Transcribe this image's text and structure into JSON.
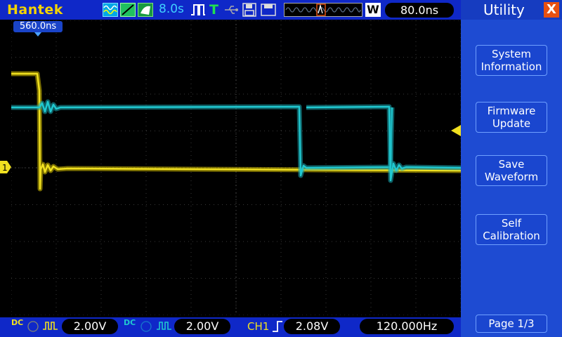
{
  "brand": "Hantek",
  "topbar": {
    "acq_time": "8.0s",
    "trigger_mode": "T",
    "timebase": "80.0ns",
    "window_label": "W",
    "trigger_position": "560.0ns"
  },
  "sidebar": {
    "title": "Utility",
    "close_label": "X",
    "items": [
      {
        "line1": "System",
        "line2": "Information"
      },
      {
        "line1": "Firmware",
        "line2": "Update"
      },
      {
        "line1": "Save",
        "line2": "Waveform"
      },
      {
        "line1": "Self",
        "line2": "Calibration"
      }
    ],
    "page_label": "Page 1/3"
  },
  "bottombar": {
    "ch1_scale": "2.00V",
    "ch2_scale": "2.00V",
    "trigger_source": "CH1",
    "trigger_level": "2.08V",
    "frequency": "120.000Hz",
    "ch1_coupling": "DC",
    "ch2_coupling": "DC"
  },
  "colors": {
    "ch1": "#f0e020",
    "ch2": "#20c8d0",
    "bar": "#0f28c8",
    "side": "#1e4bd2"
  },
  "icons": [
    "waveform-icon",
    "slope-icon",
    "pulse-icon",
    "usb-icon",
    "save-icon",
    "close-icon",
    "trigger-edge-icon",
    "trigger-marker-icon"
  ]
}
